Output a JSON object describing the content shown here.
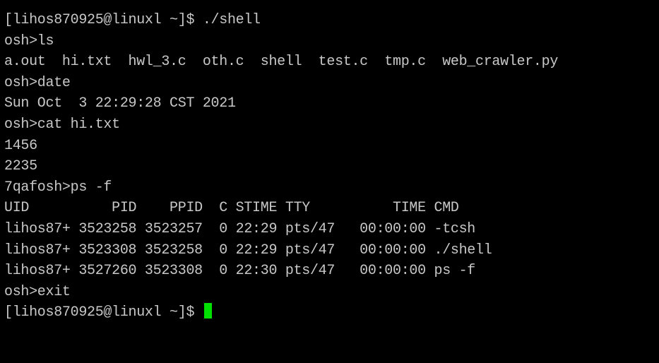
{
  "terminal": {
    "lines": [
      "[lihos870925@linuxl ~]$ ./shell",
      "osh>ls",
      "a.out  hi.txt  hwl_3.c  oth.c  shell  test.c  tmp.c  web_crawler.py",
      "osh>date",
      "Sun Oct  3 22:29:28 CST 2021",
      "osh>cat hi.txt",
      "1456",
      "2235",
      "7qafosh>ps -f",
      "UID          PID    PPID  C STIME TTY          TIME CMD",
      "lihos87+ 3523258 3523257  0 22:29 pts/47   00:00:00 -tcsh",
      "lihos87+ 3523308 3523258  0 22:29 pts/47   00:00:00 ./shell",
      "lihos87+ 3527260 3523308  0 22:30 pts/47   00:00:00 ps -f",
      "osh>exit"
    ],
    "prompt": "[lihos870925@linuxl ~]$ ",
    "colors": {
      "background": "#000000",
      "text": "#c8c8c8",
      "cursor": "#00e000"
    }
  }
}
